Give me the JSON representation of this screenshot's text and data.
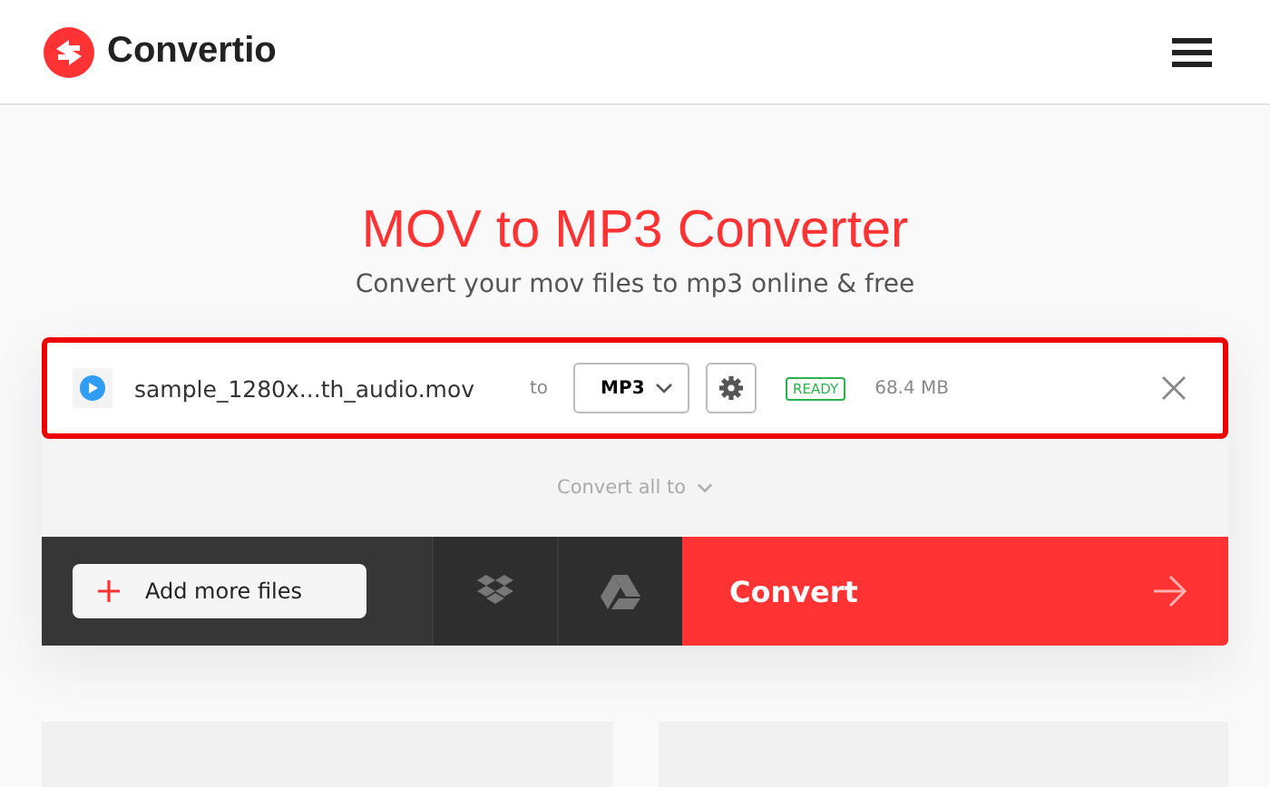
{
  "header": {
    "logo": "Convertio"
  },
  "title": "MOV to MP3 Converter",
  "subtitle": "Convert your mov files to mp3 online & free",
  "files": [
    {
      "name": "sample_1280x...th_audio.mov",
      "to_label": "to",
      "format": "MP3",
      "status": "READY",
      "size": "68.4 MB",
      "selected": true
    }
  ],
  "convert_all": "Convert all to",
  "add_button": "Add more files",
  "convert_button": "Convert"
}
